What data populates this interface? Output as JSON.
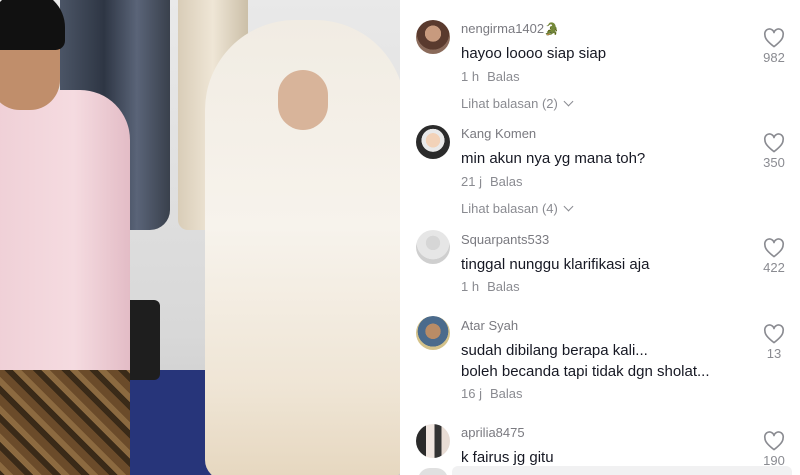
{
  "comments": [
    {
      "username": "nengirma1402",
      "username_suffix": "🐊",
      "text": [
        "hayoo loooo siap siap"
      ],
      "time": "1 h",
      "reply_label": "Balas",
      "likes": "982",
      "view_replies": "Lihat balasan (2)",
      "avatar": "avatar-woman"
    },
    {
      "username": "Kang Komen",
      "username_suffix": "",
      "text": [
        "min akun nya yg mana toh?"
      ],
      "time": "21 j",
      "reply_label": "Balas",
      "likes": "350",
      "view_replies": "Lihat balasan (4)",
      "avatar": "avatar-masked-boy"
    },
    {
      "username": "Squarpants533",
      "username_suffix": "",
      "text": [
        "tinggal nunggu klarifikasi aja"
      ],
      "time": "1 h",
      "reply_label": "Balas",
      "likes": "422",
      "view_replies": "",
      "avatar": "avatar-default"
    },
    {
      "username": "Atar Syah",
      "username_suffix": "",
      "text": [
        "sudah dibilang berapa kali...",
        "boleh becanda tapi tidak dgn sholat..."
      ],
      "time": "16 j",
      "reply_label": "Balas",
      "likes": "13",
      "view_replies": "",
      "avatar": "avatar-man"
    },
    {
      "username": "aprilia8475",
      "username_suffix": "",
      "text": [
        "k fairus jg gitu"
      ],
      "time": "",
      "reply_label": "",
      "likes": "190",
      "view_replies": "",
      "avatar": "avatar-couple"
    }
  ],
  "colors": {
    "text": "#161823",
    "muted": "#8a8b91",
    "username": "#7a7a80",
    "croc": "#41a36a"
  }
}
